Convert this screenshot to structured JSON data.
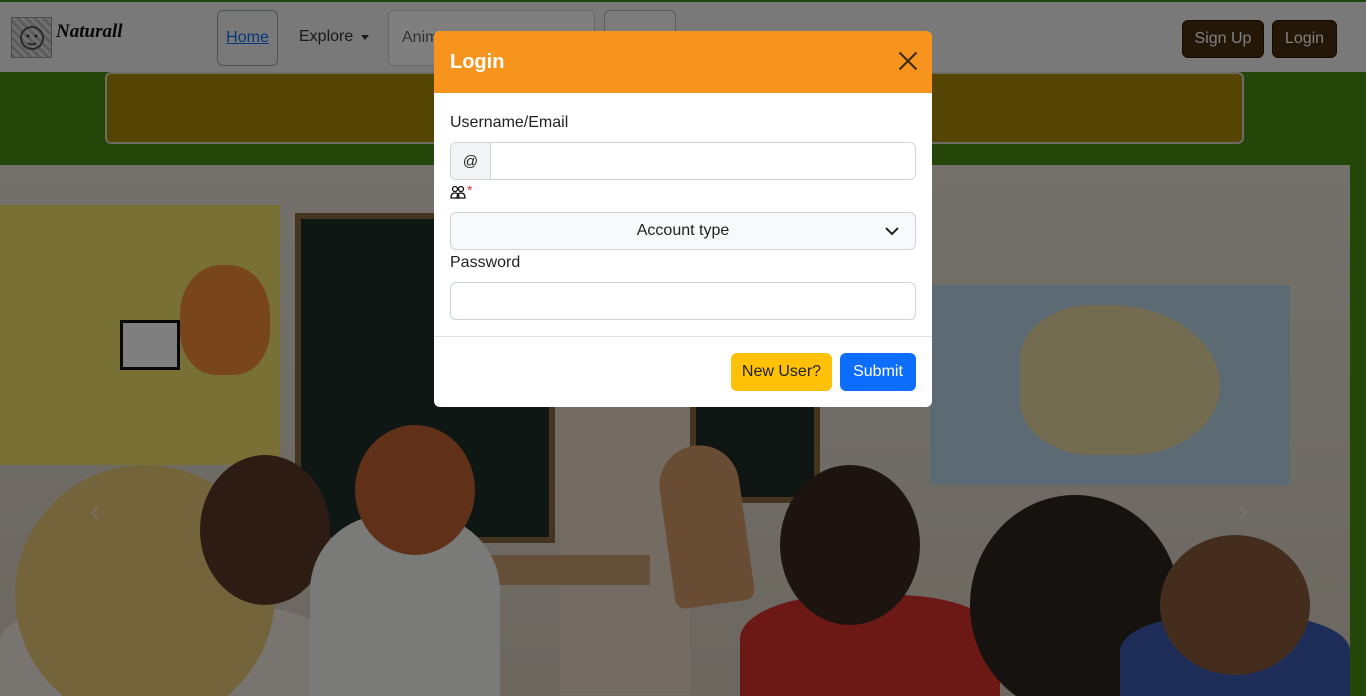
{
  "navbar": {
    "brand": "Naturall",
    "home": "Home",
    "explore": "Explore",
    "search_placeholder": "Anim",
    "signup": "Sign Up",
    "login": "Login"
  },
  "modal": {
    "title": "Login",
    "username_label": "Username/Email",
    "at_symbol": "@",
    "required_mark": "*",
    "account_type_placeholder": "Account type",
    "password_label": "Password",
    "new_user": "New User?",
    "submit": "Submit"
  },
  "colors": {
    "modal_header": "#f7941d",
    "submit": "#0d6efd",
    "new_user": "#ffc107",
    "nav_buttons": "#4b2e0f"
  }
}
